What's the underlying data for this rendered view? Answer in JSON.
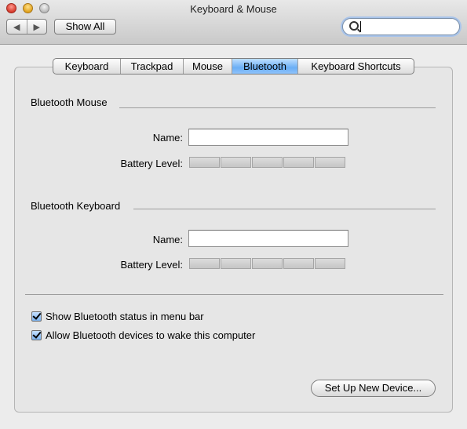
{
  "window": {
    "title": "Keyboard & Mouse"
  },
  "toolbar": {
    "back_icon": "triangle-left",
    "forward_icon": "triangle-right",
    "show_all_label": "Show All",
    "search_value": ""
  },
  "tabs": [
    {
      "label": "Keyboard",
      "selected": false
    },
    {
      "label": "Trackpad",
      "selected": false
    },
    {
      "label": "Mouse",
      "selected": false
    },
    {
      "label": "Bluetooth",
      "selected": true
    },
    {
      "label": "Keyboard Shortcuts",
      "selected": false
    }
  ],
  "mouse_section": {
    "title": "Bluetooth Mouse",
    "name_label": "Name:",
    "name_value": "",
    "battery_label": "Battery Level:"
  },
  "keyboard_section": {
    "title": "Bluetooth Keyboard",
    "name_label": "Name:",
    "name_value": "",
    "battery_label": "Battery Level:"
  },
  "options": {
    "show_status_label": "Show Bluetooth status in menu bar",
    "show_status_checked": true,
    "allow_wake_label": "Allow Bluetooth devices to wake this computer",
    "allow_wake_checked": true
  },
  "setup_button_label": "Set Up New Device...",
  "colors": {
    "selected_tab": "#6aaef5",
    "window_bg": "#ececec"
  }
}
